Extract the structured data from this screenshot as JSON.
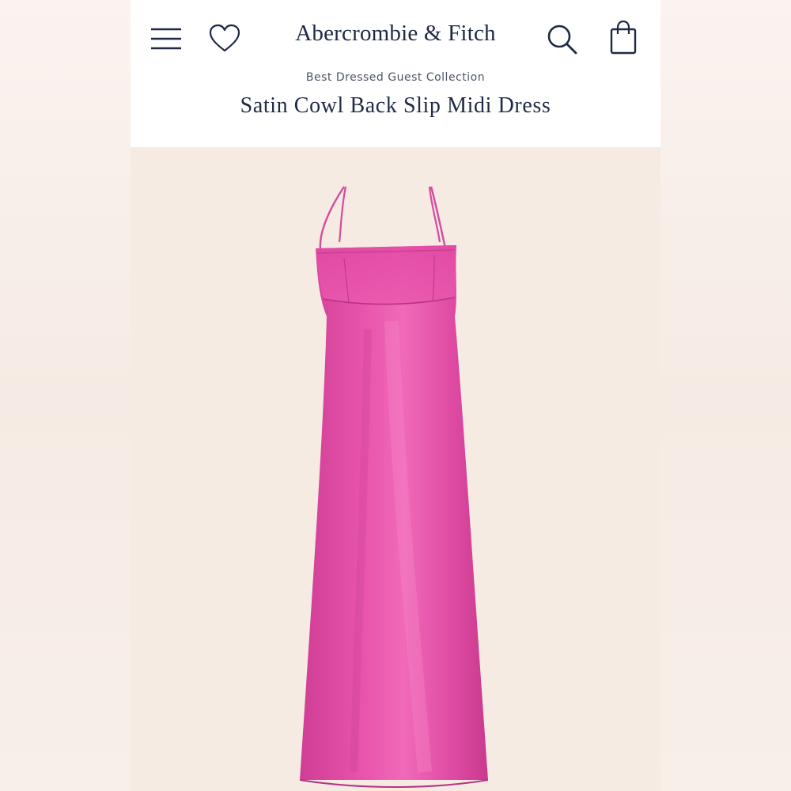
{
  "header": {
    "brand": "Abercrombie & Fitch",
    "collection": "Best Dressed Guest Collection",
    "product_title": "Satin Cowl Back Slip Midi Dress"
  },
  "icons": {
    "menu": "menu-icon",
    "wishlist": "heart-icon",
    "search": "search-icon",
    "bag": "shopping-bag-icon"
  },
  "colors": {
    "dress": "#e64fa8",
    "brand_text": "#1e2a44",
    "background": "#f5ebe3"
  }
}
